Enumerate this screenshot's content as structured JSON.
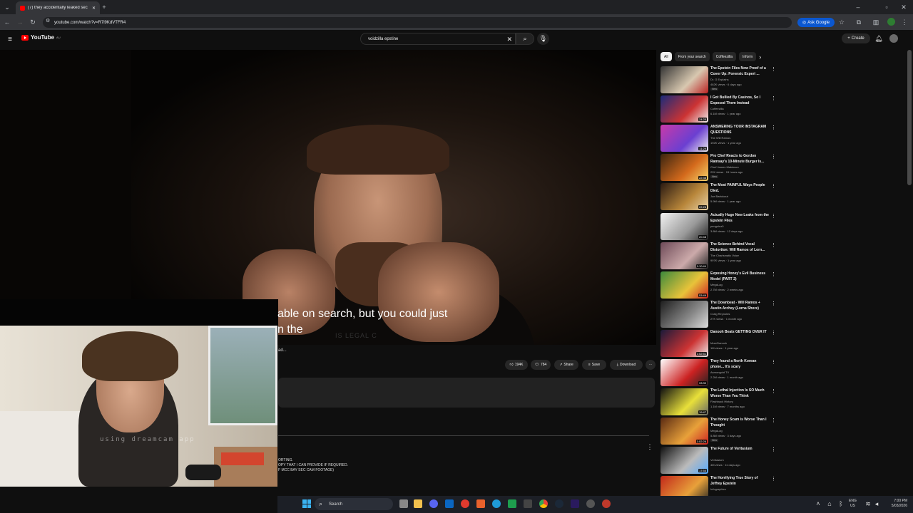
{
  "browser": {
    "tab_title": "(7) they accidentally leaked sec",
    "url": "youtube.com/watch?v=R7i9KdVTFR4",
    "ask_google": "Ask Google"
  },
  "youtube": {
    "logo": "YouTube",
    "logo_sup": "AU",
    "search_value": "voidzilla epstine",
    "create": "Create"
  },
  "video": {
    "caption_line1": "able on search, but you could just",
    "caption_line2": "n the",
    "shirt_text": "IS LEGAL C",
    "loading": "ad..."
  },
  "actions": {
    "likes": "194K",
    "comments": "784",
    "share": "Share",
    "save": "Save",
    "download": "Download"
  },
  "comment": {
    "line1": "ORTING.",
    "line2": "OPY THAT I CAN PROVIDE IF REQUIRED.",
    "line3": "F MCC BAY SEC CAM FOOTAGE)"
  },
  "webcam": {
    "overlay": "using dreamcam app"
  },
  "chips": [
    "All",
    "From your search",
    "Coffeezilla",
    "Inform"
  ],
  "recommendations": [
    {
      "title": "The Epstein Files Now Proof of a Cover Up: Forensic Expert ...",
      "channel": "Dr. G Explains",
      "stats": "462K views · 6 days ago",
      "badge": "New",
      "duration": "",
      "thumb": [
        "#333",
        "#d8c8b0",
        "#b22"
      ]
    },
    {
      "title": "I Got Bullied By Casinos, So I Exposed Them Instead",
      "channel": "Coffeezilla",
      "stats": "6.1M views · 1 year ago",
      "badge": "",
      "duration": "24:25",
      "thumb": [
        "#1a2b7a",
        "#c33",
        "#eee"
      ]
    },
    {
      "title": "ANSWERING YOUR INSTAGRAM QUESTIONS",
      "channel": "The Will Ramos",
      "stats": "192K views · 1 year ago",
      "badge": "",
      "duration": "11:29",
      "thumb": [
        "#c93aa8",
        "#6b3fd1",
        "#eee"
      ]
    },
    {
      "title": "Pro Chef Reacts to Gordon Ramsay's 10-Minute Burger Is...",
      "channel": "Chef James Makinson",
      "stats": "22K views · 15 hours ago",
      "badge": "New",
      "duration": "22:38",
      "thumb": [
        "#3a2410",
        "#d46a1c",
        "#f5d36b"
      ]
    },
    {
      "title": "The Most PAINFUL Ways People Died.",
      "channel": "Joe Bartolozzi",
      "stats": "5.9M views · 1 year ago",
      "badge": "",
      "duration": "22:26",
      "thumb": [
        "#2a1a12",
        "#b8863a",
        "#e7d2a8"
      ]
    },
    {
      "title": "Actually Huge New Leaks from the Epstein Files",
      "channel": "penguinz0",
      "stats": "3.8M views · 12 days ago",
      "badge": "",
      "duration": "20:48",
      "thumb": [
        "#f2f2f2",
        "#999",
        "#222"
      ]
    },
    {
      "title": "The Science Behind Vocal Distortion: Will Ramos of Lorn...",
      "channel": "The Charismatic Voice",
      "stats": "997K views · 1 year ago",
      "badge": "",
      "duration": "1:10:44",
      "thumb": [
        "#6e4a58",
        "#caa",
        "#222"
      ]
    },
    {
      "title": "Exposing Honey's Evil Business Model (PART 2)",
      "channel": "MegaLag",
      "stats": "2.7M views · 2 weeks ago",
      "badge": "",
      "duration": "53:49",
      "thumb": [
        "#3c8a3c",
        "#e8c33a",
        "#c22"
      ]
    },
    {
      "title": "The Downbeat - Will Ramos + Austin Archey (Lorna Shore)",
      "channel": "Craig Reynolds",
      "stats": "27K views · 1 month ago",
      "badge": "",
      "duration": "",
      "thumb": [
        "#1e1e1e",
        "#888",
        "#ddd"
      ]
    },
    {
      "title": "Danooh Beats GETTING OVER IT",
      "channel": "MoreDanooh",
      "stats": "1M views · 1 year ago",
      "badge": "",
      "duration": "1:52:51",
      "thumb": [
        "#1a1a3a",
        "#c33",
        "#eee"
      ]
    },
    {
      "title": "They found a North Korean phone... It's scary",
      "channel": "Asmongold TV",
      "stats": "2.2M views · 1 month ago",
      "badge": "",
      "duration": "33:30",
      "thumb": [
        "#fff",
        "#c22",
        "#222"
      ]
    },
    {
      "title": "The Lethal Injection Is SO Much Worse Than You Think",
      "channel": "Flashback History",
      "stats": "1.1M views · 7 months ago",
      "badge": "",
      "duration": "19:47",
      "thumb": [
        "#111",
        "#e8e03a",
        "#666"
      ]
    },
    {
      "title": "The Honey Scam is Worse Than I Thought",
      "channel": "MegaLag",
      "stats": "5.8M views · 3 days ago",
      "badge": "New",
      "duration": "1:02:26",
      "thumb": [
        "#5a2a12",
        "#e8a13a",
        "#c22"
      ]
    },
    {
      "title": "The Future of Veritasium",
      "channel": "Veritasium",
      "stats": "4M views · 11 days ago",
      "badge": "",
      "duration": "17:55",
      "thumb": [
        "#101010",
        "#bbb",
        "#5af"
      ]
    },
    {
      "title": "The Horrifying True Story of Jeffrey Epstein",
      "channel": "Infographics",
      "stats": "",
      "badge": "",
      "duration": "",
      "thumb": [
        "#c2281a",
        "#e8a13a",
        "#222"
      ]
    }
  ],
  "taskbar": {
    "search": "Search",
    "lang1": "ENG",
    "lang2": "US",
    "time": "7:00 PM",
    "date": "5/03/2026"
  }
}
